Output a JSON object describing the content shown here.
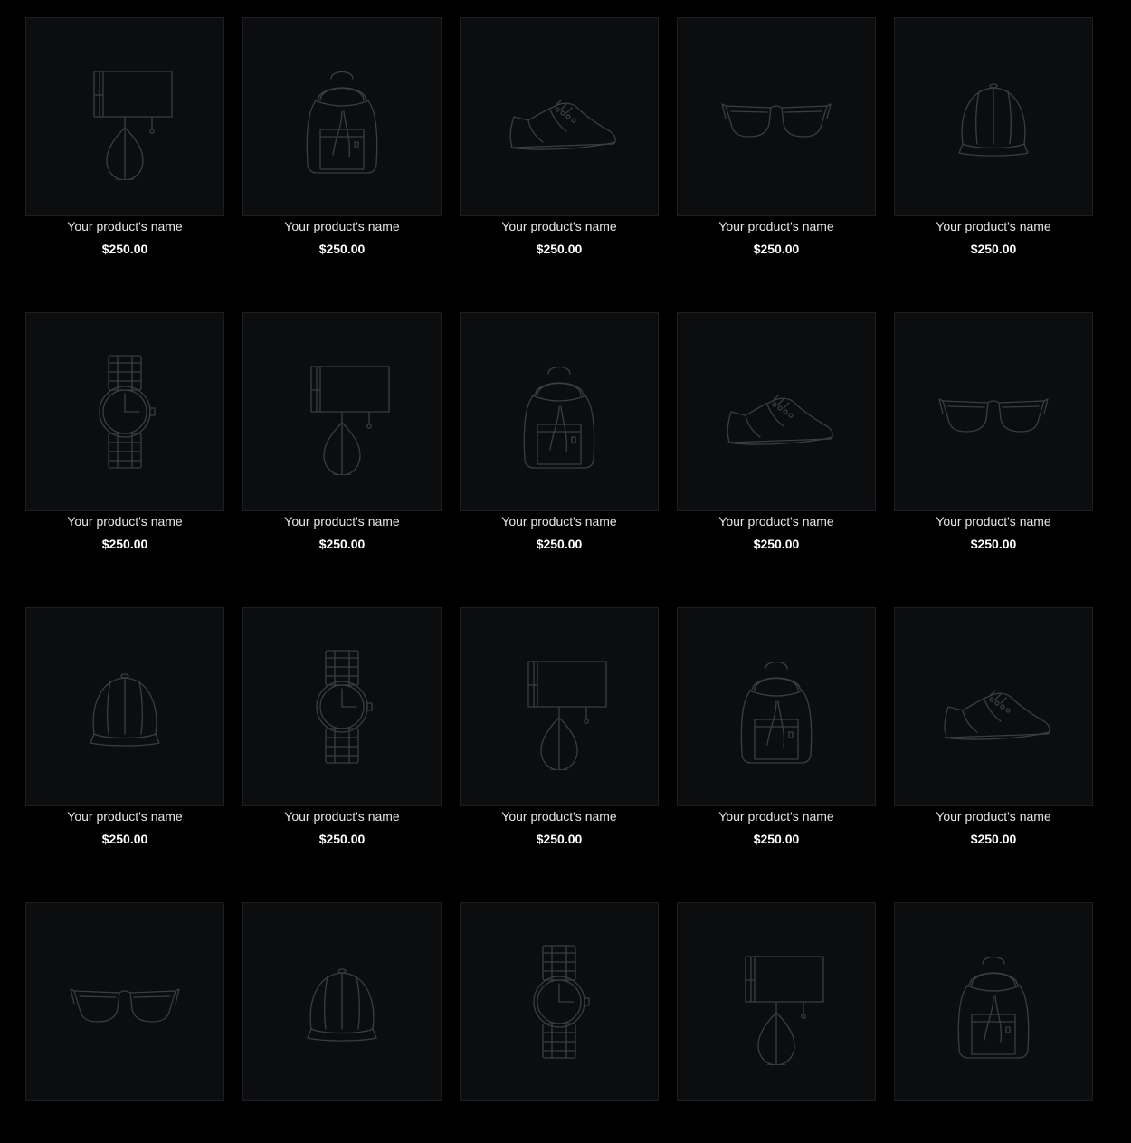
{
  "products": [
    {
      "icon": "lamp-icon",
      "name": "Your product's name",
      "price": "$250.00"
    },
    {
      "icon": "backpack-icon",
      "name": "Your product's name",
      "price": "$250.00"
    },
    {
      "icon": "sneaker-icon",
      "name": "Your product's name",
      "price": "$250.00"
    },
    {
      "icon": "sunglasses-icon",
      "name": "Your product's name",
      "price": "$250.00"
    },
    {
      "icon": "cap-icon",
      "name": "Your product's name",
      "price": "$250.00"
    },
    {
      "icon": "watch-icon",
      "name": "Your product's name",
      "price": "$250.00"
    },
    {
      "icon": "lamp-icon",
      "name": "Your product's name",
      "price": "$250.00"
    },
    {
      "icon": "backpack-icon",
      "name": "Your product's name",
      "price": "$250.00"
    },
    {
      "icon": "sneaker-icon",
      "name": "Your product's name",
      "price": "$250.00"
    },
    {
      "icon": "sunglasses-icon",
      "name": "Your product's name",
      "price": "$250.00"
    },
    {
      "icon": "cap-icon",
      "name": "Your product's name",
      "price": "$250.00"
    },
    {
      "icon": "watch-icon",
      "name": "Your product's name",
      "price": "$250.00"
    },
    {
      "icon": "lamp-icon",
      "name": "Your product's name",
      "price": "$250.00"
    },
    {
      "icon": "backpack-icon",
      "name": "Your product's name",
      "price": "$250.00"
    },
    {
      "icon": "sneaker-icon",
      "name": "Your product's name",
      "price": "$250.00"
    },
    {
      "icon": "sunglasses-icon"
    },
    {
      "icon": "cap-icon"
    },
    {
      "icon": "watch-icon"
    },
    {
      "icon": "lamp-icon"
    },
    {
      "icon": "backpack-icon"
    }
  ]
}
